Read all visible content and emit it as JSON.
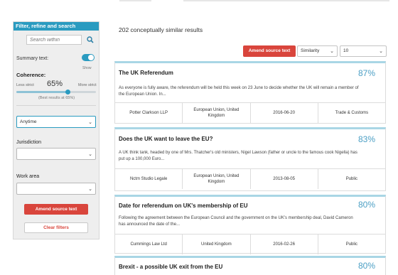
{
  "sidebar": {
    "header": "Filter, refine and search",
    "search_placeholder": "Search within",
    "summary_label": "Summary text:",
    "summary_toggle_label": "Show",
    "summary_on": true,
    "coherence_label": "Coherence:",
    "less_strict": "Less strict",
    "more_strict": "More strict",
    "coherence_value": "65%",
    "coherence_level": 0.65,
    "best_results": "(Best results at 65%)",
    "date_select": "Anytime",
    "jurisdiction_label": "Jurisdiction",
    "jurisdiction_value": "",
    "work_area_label": "Work area",
    "work_area_value": "",
    "amend_button": "Amend source text",
    "clear_button": "Clear filters"
  },
  "main": {
    "results_count": "202 conceptually similar results",
    "amend_button": "Amend source text",
    "sort_value": "Similarity",
    "count_value": "10",
    "results": [
      {
        "title": "The UK Referendum",
        "score": "87%",
        "snippet": "As everyone is fully aware, the referendum will be held this week on 23 June to decide whether the UK will remain a member of the European Union. In...",
        "meta": [
          "Potter Clarkson LLP",
          "European Union, United Kingdom",
          "2016-06-20",
          "Trade & Customs"
        ]
      },
      {
        "title": "Does the UK want to leave the EU?",
        "score": "83%",
        "snippet": "A UK think tank, headed by one of Mrs. Thatcher's old ministers, Nigel Lawson (father or uncle to the famous cook Nigella) has put up a 100,000 Euro...",
        "meta": [
          "Nctm Studio Legale",
          "European Union, United Kingdom",
          "2013-08-05",
          "Public"
        ]
      },
      {
        "title": "Date for referendum on UK's membership of EU",
        "score": "80%",
        "snippet": "Following the agreement between the European Council and the government on the UK's membership deal, David Cameron has announced the date of the...",
        "meta": [
          "Cummings Law Ltd",
          "United Kingdom",
          "2016-02-26",
          "Public"
        ]
      },
      {
        "title": "Brexit - a possible UK exit from the EU",
        "score": "80%",
        "snippet": "",
        "meta": []
      }
    ]
  },
  "colors": {
    "accent": "#2a9bc0",
    "button_red": "#d9453c",
    "score_blue": "#4b9fc4"
  }
}
